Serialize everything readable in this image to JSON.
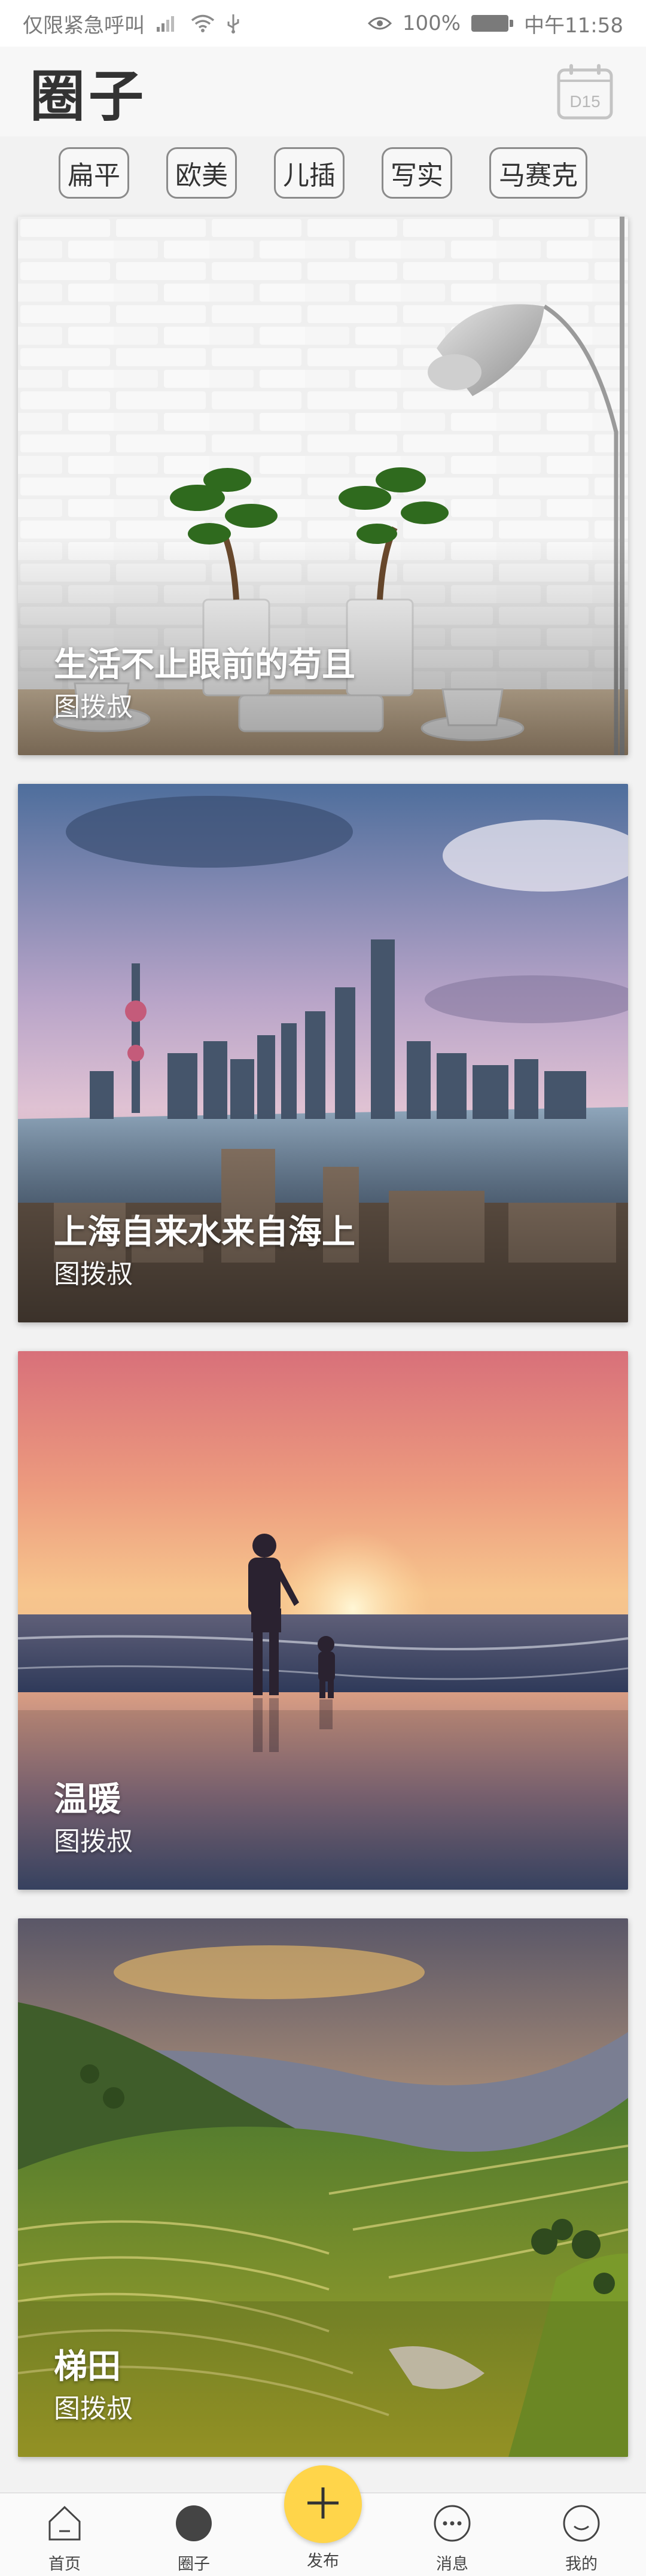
{
  "status_bar": {
    "left_text": "仅限紧急呼叫",
    "battery_text": "100%",
    "battery_level": 1.0,
    "time_text": "中午11:58",
    "icons": [
      "signal-icon",
      "wifi-icon",
      "usb-icon",
      "eye-icon",
      "battery-icon"
    ]
  },
  "header": {
    "title": "圈子",
    "calendar_label": "D15",
    "calendar_icon": "calendar-icon"
  },
  "tags": [
    {
      "label": "扁平"
    },
    {
      "label": "欧美"
    },
    {
      "label": "儿插"
    },
    {
      "label": "写实"
    },
    {
      "label": "马赛克"
    }
  ],
  "cards": [
    {
      "title": "生活不止眼前的苟且",
      "author": "图拨叔"
    },
    {
      "title": "上海自来水来自海上",
      "author": "图拨叔"
    },
    {
      "title": "温暖",
      "author": "图拨叔"
    },
    {
      "title": "梯田",
      "author": "图拨叔"
    }
  ],
  "bottom_nav": {
    "items": [
      {
        "label": "首页",
        "icon": "home-icon"
      },
      {
        "label": "圈子",
        "icon": "circle-icon"
      },
      {
        "label": "发布",
        "icon": "plus-icon"
      },
      {
        "label": "消息",
        "icon": "message-icon"
      },
      {
        "label": "我的",
        "icon": "profile-icon"
      }
    ],
    "publish_color": "#ffd54a"
  }
}
